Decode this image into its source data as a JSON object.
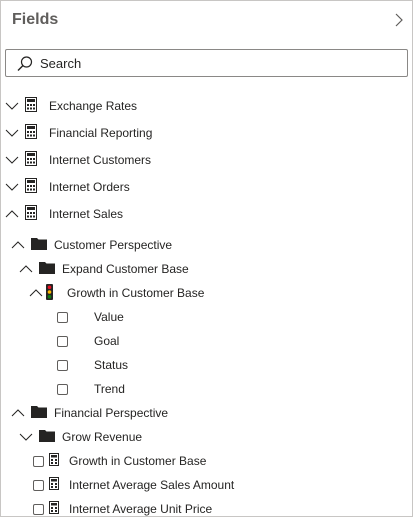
{
  "pane": {
    "title": "Fields",
    "collapse_icon": "chevron-right-icon"
  },
  "search": {
    "placeholder": "Search",
    "icon": "search-icon"
  },
  "tables": [
    {
      "label": "Exchange Rates",
      "expanded": false,
      "icon": "calculator-table-icon"
    },
    {
      "label": "Financial Reporting",
      "expanded": false,
      "icon": "calculator-table-icon"
    },
    {
      "label": "Internet Customers",
      "expanded": false,
      "icon": "calculator-table-icon"
    },
    {
      "label": "Internet Orders",
      "expanded": false,
      "icon": "calculator-table-icon"
    },
    {
      "label": "Internet Sales",
      "expanded": true,
      "icon": "calculator-table-icon"
    }
  ],
  "folders": {
    "customer_perspective": "Customer Perspective",
    "expand_customer_base": "Expand Customer Base",
    "financial_perspective": "Financial Perspective",
    "grow_revenue": "Grow Revenue"
  },
  "kpi": {
    "label": "Growth in Customer Base",
    "icon": "kpi-traffic-light-icon",
    "children": [
      "Value",
      "Goal",
      "Status",
      "Trend"
    ]
  },
  "measures": [
    {
      "label": "Growth in Customer Base",
      "checked": false
    },
    {
      "label": "Internet Average Sales Amount",
      "checked": false
    },
    {
      "label": "Internet Average Unit Price",
      "checked": false
    }
  ],
  "colors": {
    "text": "#252423",
    "border": "#c8c6c4",
    "icon": "#252423",
    "kpi_red": "#e81123",
    "kpi_yellow": "#ffb900",
    "kpi_green": "#107c10"
  }
}
